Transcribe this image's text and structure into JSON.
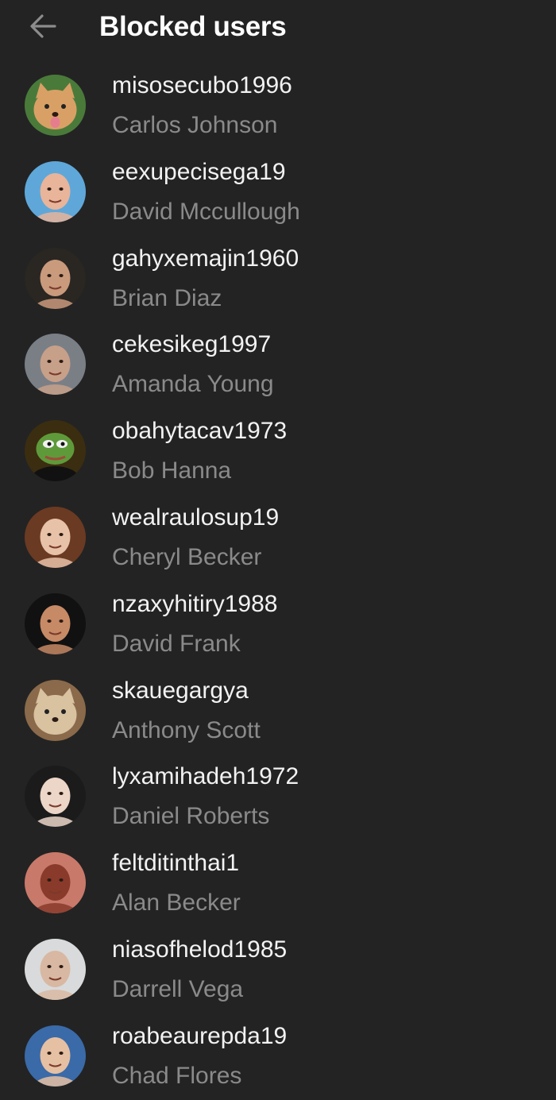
{
  "header": {
    "back_icon": "arrow-left-icon",
    "title": "Blocked users"
  },
  "users": [
    {
      "username": "misosecubo1996",
      "name": "Carlos Johnson",
      "avatar_icon": "dog-avatar",
      "avatar_bg": "#4a7a3a",
      "avatar_fg": "#d9a066"
    },
    {
      "username": "eexupecisega19",
      "name": "David Mccullough",
      "avatar_icon": "face-avatar",
      "avatar_bg": "#5fa7d9",
      "avatar_fg": "#e8b49a"
    },
    {
      "username": "gahyxemajin1960",
      "name": "Brian Diaz",
      "avatar_icon": "face-avatar",
      "avatar_bg": "#2a2622",
      "avatar_fg": "#c99a7c"
    },
    {
      "username": "cekesikeg1997",
      "name": "Amanda Young",
      "avatar_icon": "face-avatar",
      "avatar_bg": "#7a7f86",
      "avatar_fg": "#c7a08a"
    },
    {
      "username": "obahytacav1973",
      "name": "Bob Hanna",
      "avatar_icon": "frog-avatar",
      "avatar_bg": "#3b2d10",
      "avatar_fg": "#5f9a3a"
    },
    {
      "username": "wealraulosup19",
      "name": "Cheryl Becker",
      "avatar_icon": "face-avatar",
      "avatar_bg": "#6b3a22",
      "avatar_fg": "#e8c2a8"
    },
    {
      "username": "nzaxyhitiry1988",
      "name": "David Frank",
      "avatar_icon": "face-avatar",
      "avatar_bg": "#111111",
      "avatar_fg": "#c78a66"
    },
    {
      "username": "skauegargya",
      "name": "Anthony Scott",
      "avatar_icon": "cat-avatar",
      "avatar_bg": "#8a6a4a",
      "avatar_fg": "#d8c2a0"
    },
    {
      "username": "lyxamihadeh1972",
      "name": "Daniel Roberts",
      "avatar_icon": "face-avatar",
      "avatar_bg": "#1b1b1b",
      "avatar_fg": "#ecd6c8"
    },
    {
      "username": "feltditinthai1",
      "name": "Alan Becker",
      "avatar_icon": "face-avatar",
      "avatar_bg": "#c8796a",
      "avatar_fg": "#8a3a2a"
    },
    {
      "username": "niasofhelod1985",
      "name": "Darrell Vega",
      "avatar_icon": "face-avatar",
      "avatar_bg": "#d9dadb",
      "avatar_fg": "#d8b8a2"
    },
    {
      "username": "roabeaurepda19",
      "name": "Chad Flores",
      "avatar_icon": "face-avatar",
      "avatar_bg": "#3a6aa8",
      "avatar_fg": "#e6c0a2"
    }
  ]
}
